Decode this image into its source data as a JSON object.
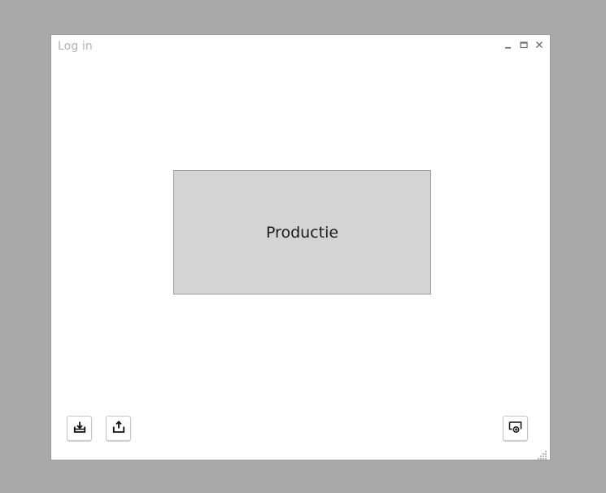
{
  "window": {
    "title": "Log in",
    "controls": {
      "minimize_icon": "minimize-icon",
      "maximize_icon": "maximize-icon",
      "close_icon": "close-icon"
    }
  },
  "main": {
    "production_button_label": "Productie"
  },
  "toolbar": {
    "left_buttons": [
      {
        "icon": "download-icon"
      },
      {
        "icon": "upload-icon"
      }
    ],
    "right_button": {
      "icon": "screen-add-icon"
    }
  },
  "colors": {
    "backdrop": "#a9a9a9",
    "window_bg": "#ffffff",
    "button_bg": "#d4d4d4",
    "title_text": "#b3b3b3"
  }
}
